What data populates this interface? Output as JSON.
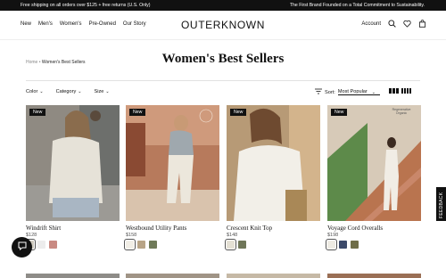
{
  "promo": {
    "left": "Free shipping on all orders over $125 + free returns (U.S. Only)",
    "right": "The First Brand Founded on a Total Commitment to Sustainability."
  },
  "nav": [
    "New",
    "Men's",
    "Women's",
    "Pre-Owned",
    "Our Story"
  ],
  "logo": "OUTERKNOWN",
  "account": "Account",
  "icons": {
    "search": "search-icon",
    "wishlist": "heart-icon",
    "bag": "bag-icon",
    "sort": "sort-icon",
    "chat": "chat-icon"
  },
  "breadcrumb": {
    "home": "Home",
    "separator": "•",
    "current": "Women's Best Sellers"
  },
  "page_title": "Women's Best Sellers",
  "filters": [
    "Color",
    "Category",
    "Size"
  ],
  "sort": {
    "label": "Sort:",
    "value": "Most Popular"
  },
  "products": [
    {
      "badge": "New",
      "name": "Windrift Shirt",
      "price": "$128",
      "swatches": [
        "#cfcabe",
        "#ececec",
        "#c98a82"
      ]
    },
    {
      "badge": "New",
      "name": "Westbound Utility Pants",
      "price": "$158",
      "swatches": [
        "#f1eee6",
        "#b8a486",
        "#6f7a58"
      ]
    },
    {
      "badge": "New",
      "name": "Crescent Knit Top",
      "price": "$148",
      "swatches": [
        "#e4e0d4",
        "#6f7658"
      ]
    },
    {
      "badge": "New",
      "name": "Voyage Cord Overalls",
      "price": "$198",
      "seal": "Regenerative Organic",
      "swatches": [
        "#eeebe3",
        "#3c4a6a",
        "#6f6d48"
      ]
    }
  ],
  "feedback": "FEEDBACK",
  "colors": {
    "promo_bg": "#111111",
    "badge_bg": "#111111"
  }
}
